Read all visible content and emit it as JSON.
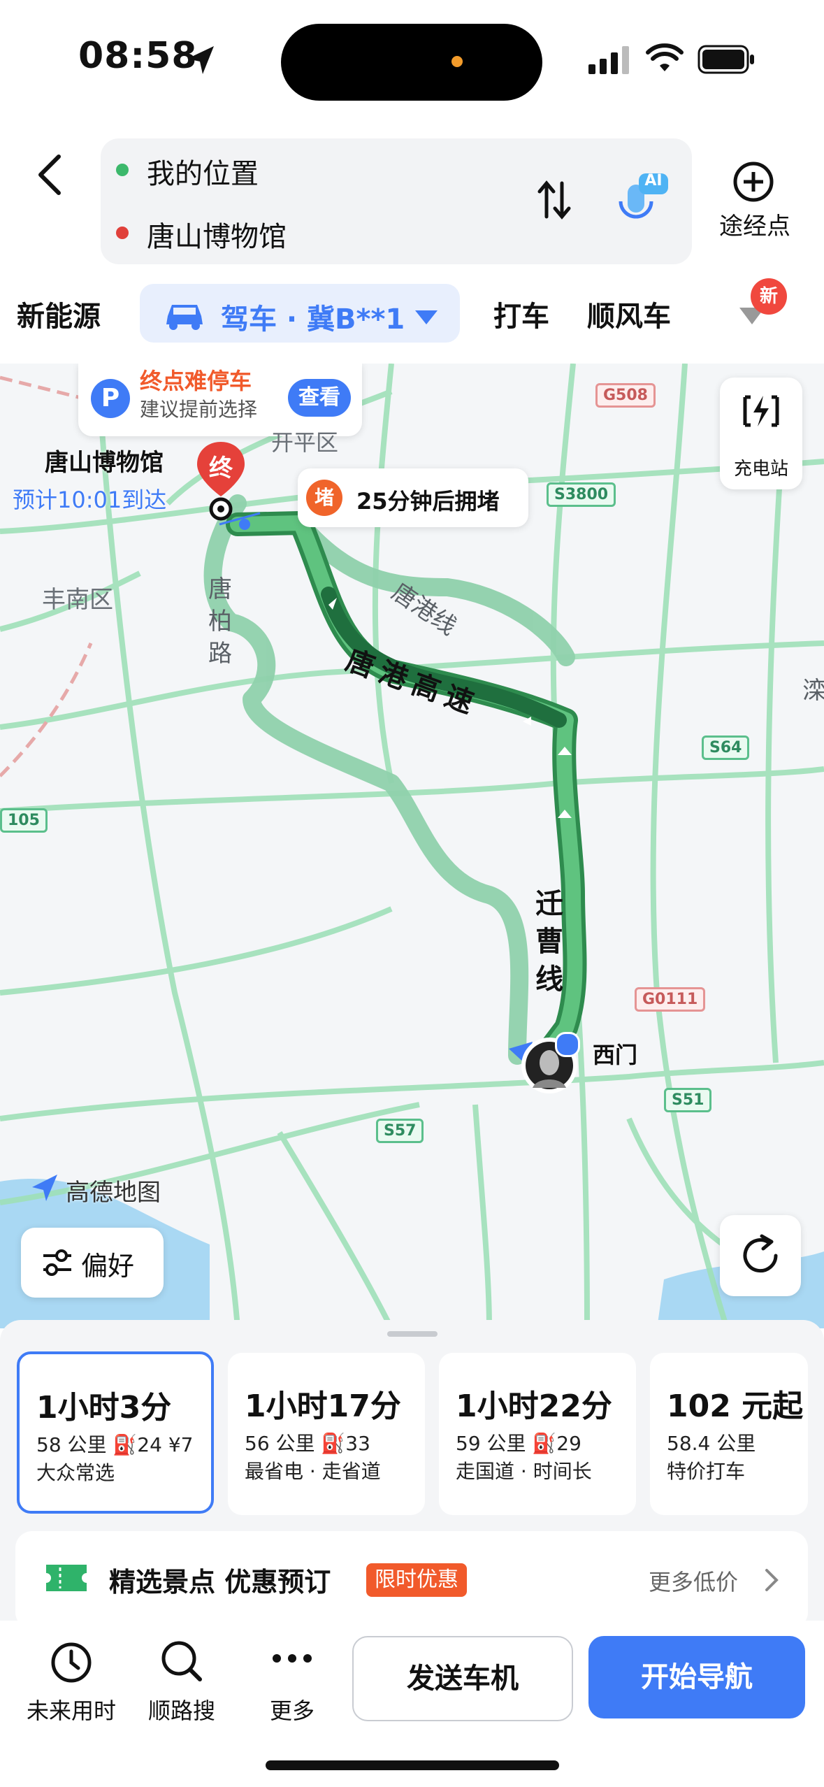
{
  "status": {
    "time": "08:58"
  },
  "search": {
    "origin": "我的位置",
    "destination": "唐山博物馆",
    "via_label": "途经点",
    "ai_badge": "AI"
  },
  "tabs": {
    "new_energy": "新能源",
    "drive": "驾车 · 冀B**1",
    "taxi": "打车",
    "carpool": "顺风车",
    "new_badge": "新"
  },
  "map": {
    "parking_title": "终点难停车",
    "parking_sub": "建议提前选择",
    "parking_btn": "查看",
    "dest_name": "唐山博物馆",
    "eta": "预计10:01到达",
    "end_marker": "终",
    "jam_badge": "堵",
    "jam_text": "25分钟后拥堵",
    "charging": "充电站",
    "district1": "丰南区",
    "district2": "开平区",
    "road_tanggang_line": "唐港线",
    "road_tangbai": "唐柏路",
    "road_tanggang_exp": "唐港高速",
    "road_qiancao": "迁曹线",
    "west_gate": "西门",
    "logo": "高德地图",
    "preference": "偏好",
    "shields": [
      "G508",
      "S3800",
      "S64",
      "G0111",
      "S51",
      "S57",
      "105"
    ],
    "edge_text": "滦"
  },
  "routes": [
    {
      "time": "1小时3分",
      "line1": "58 公里  ⛽24  ¥7",
      "line2": "大众常选",
      "selected": true
    },
    {
      "time": "1小时17分",
      "line1": "56 公里  ⛽33",
      "line2": "最省电 · 走省道",
      "selected": false
    },
    {
      "time": "1小时22分",
      "line1": "59 公里  ⛽29",
      "line2": "走国道 · 时间长",
      "selected": false
    },
    {
      "time": "102 元起",
      "line1": "58.4 公里",
      "line2": "特价打车",
      "selected": false
    }
  ],
  "promo": {
    "title": "精选景点 优惠预订",
    "tag": "限时优惠",
    "more": "更多低价"
  },
  "bottom": {
    "future": "未来用时",
    "along": "顺路搜",
    "more": "更多",
    "send": "发送车机",
    "start": "开始导航"
  },
  "colors": {
    "accent": "#3f7bf6",
    "route_main": "#3aa864",
    "route_alt": "#8fd1ac",
    "promo_tag": "#f15a2b"
  }
}
